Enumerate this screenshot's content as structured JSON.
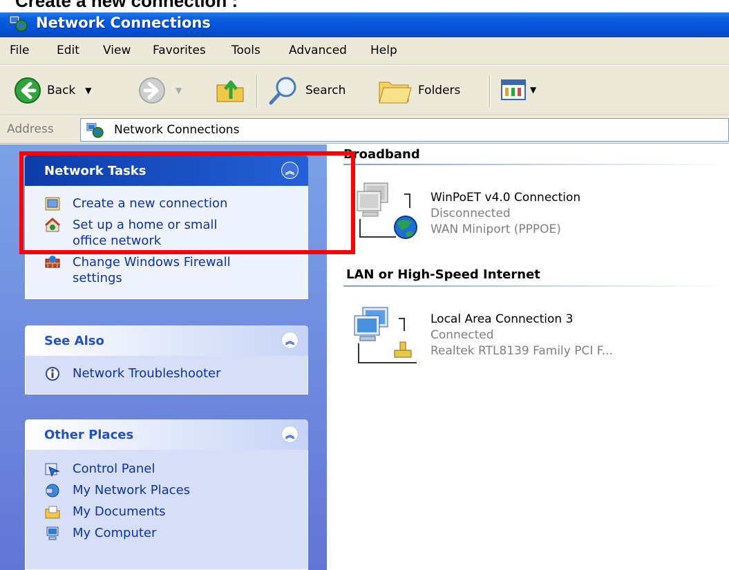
{
  "caption": "Create a new connection :",
  "window": {
    "title": "Network Connections"
  },
  "menu": [
    "File",
    "Edit",
    "View",
    "Favorites",
    "Tools",
    "Advanced",
    "Help"
  ],
  "toolbar": {
    "back_label": "Back",
    "search_label": "Search",
    "folders_label": "Folders"
  },
  "address": {
    "label": "Address",
    "value": "Network Connections"
  },
  "panels": {
    "network_tasks": {
      "title": "Network Tasks",
      "items": [
        "Create a new connection",
        "Set up a home or small office network",
        "Change Windows Firewall settings"
      ]
    },
    "see_also": {
      "title": "See Also",
      "items": [
        "Network Troubleshooter"
      ]
    },
    "other_places": {
      "title": "Other Places",
      "items": [
        "Control Panel",
        "My Network Places",
        "My Documents",
        "My Computer"
      ]
    }
  },
  "groups": {
    "broadband": {
      "title": "Broadband",
      "connection": {
        "name": "WinPoET v4.0 Connection",
        "status": "Disconnected",
        "device": "WAN Miniport (PPPOE)"
      }
    },
    "lan": {
      "title": "LAN or High-Speed Internet",
      "connection": {
        "name": "Local Area Connection 3",
        "status": "Connected",
        "device": "Realtek RTL8139 Family PCI F..."
      }
    }
  },
  "colors": {
    "titlebar": "#0553d8",
    "highlight": "#ff0000",
    "panel_head": "#ffffff",
    "link": "#0c32a8"
  }
}
